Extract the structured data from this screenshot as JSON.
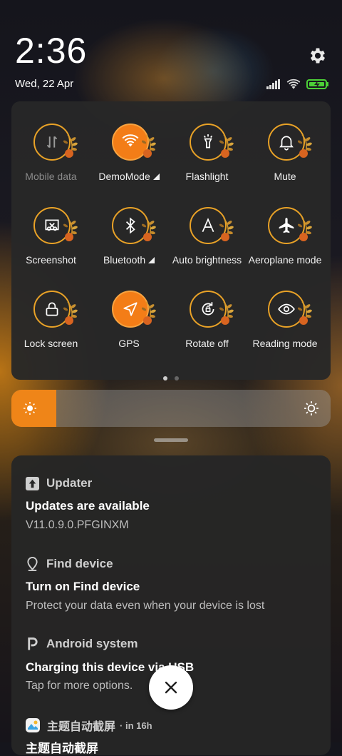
{
  "clock": {
    "time": "2:36",
    "date": "Wed, 22 Apr"
  },
  "quick_settings": {
    "tiles": [
      {
        "label": "Mobile data",
        "icon": "mobile-data-icon",
        "active": false,
        "disabled": true,
        "expand": false
      },
      {
        "label": "DemoMode",
        "icon": "wifi-icon",
        "active": true,
        "disabled": false,
        "expand": true
      },
      {
        "label": "Flashlight",
        "icon": "flashlight-icon",
        "active": false,
        "disabled": false,
        "expand": false
      },
      {
        "label": "Mute",
        "icon": "bell-icon",
        "active": false,
        "disabled": false,
        "expand": false
      },
      {
        "label": "Screenshot",
        "icon": "screenshot-icon",
        "active": false,
        "disabled": false,
        "expand": false
      },
      {
        "label": "Bluetooth",
        "icon": "bluetooth-icon",
        "active": false,
        "disabled": false,
        "expand": true
      },
      {
        "label": "Auto brightness",
        "icon": "auto-brightness-icon",
        "active": false,
        "disabled": false,
        "expand": false
      },
      {
        "label": "Aeroplane mode",
        "icon": "airplane-icon",
        "active": false,
        "disabled": false,
        "expand": false
      },
      {
        "label": "Lock screen",
        "icon": "lock-icon",
        "active": false,
        "disabled": false,
        "expand": false
      },
      {
        "label": "GPS",
        "icon": "location-icon",
        "active": true,
        "disabled": false,
        "expand": false
      },
      {
        "label": "Rotate off",
        "icon": "rotation-lock-icon",
        "active": false,
        "disabled": false,
        "expand": false
      },
      {
        "label": "Reading mode",
        "icon": "eye-icon",
        "active": false,
        "disabled": false,
        "expand": false
      }
    ],
    "page_count": 2,
    "current_page": 1
  },
  "brightness": {
    "level_fraction": 0.14
  },
  "notifications": [
    {
      "app": "Updater",
      "title": "Updates are available",
      "text": "V11.0.9.0.PFGINXM"
    },
    {
      "app": "Find device",
      "title": "Turn on Find device",
      "text": "Protect your data even when your device is lost"
    },
    {
      "app": "Android system",
      "title": "Charging this device via USB",
      "text": "Tap for more options."
    },
    {
      "app": "主题自动截屏",
      "time": "in 16h",
      "title": "主题自动截屏"
    }
  ],
  "colors": {
    "accent": "#f37d17",
    "ring": "#e9a227",
    "battery": "#4cd137"
  }
}
